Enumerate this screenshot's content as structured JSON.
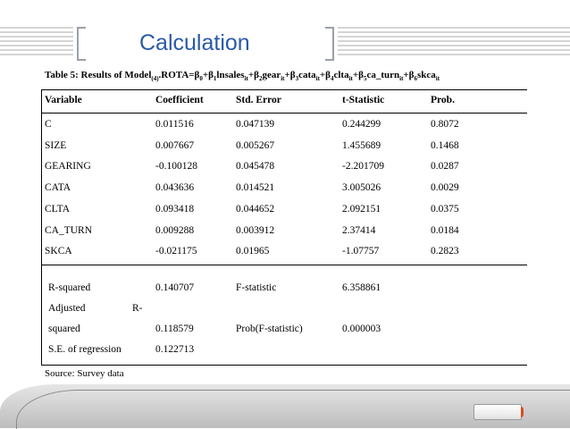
{
  "slide": {
    "title": "Calculation"
  },
  "caption": {
    "prefix": "Table 5: Results of Model",
    "model_sub": "(4)",
    "formula_parts": [
      {
        "t": ".ROTA=β"
      },
      {
        "s": "0"
      },
      {
        "t": "+β"
      },
      {
        "s": "1"
      },
      {
        "t": "lnsales"
      },
      {
        "s": "it"
      },
      {
        "t": "+β"
      },
      {
        "s": "2"
      },
      {
        "t": "gear"
      },
      {
        "s": "it"
      },
      {
        "t": "+β"
      },
      {
        "s": "3"
      },
      {
        "t": "cata"
      },
      {
        "s": "it"
      },
      {
        "t": "+β"
      },
      {
        "s": "4"
      },
      {
        "t": "clta"
      },
      {
        "s": "it"
      },
      {
        "t": "+β"
      },
      {
        "s": "5"
      },
      {
        "t": "ca_turn"
      },
      {
        "s": "it"
      },
      {
        "t": "+β"
      },
      {
        "s": "6"
      },
      {
        "t": "skca"
      },
      {
        "s": "it"
      }
    ]
  },
  "table": {
    "headers": [
      "Variable",
      "Coefficient",
      "Std. Error",
      "t-Statistic",
      "Prob."
    ],
    "rows": [
      [
        "C",
        "0.011516",
        "0.047139",
        "0.244299",
        "0.8072"
      ],
      [
        "SIZE",
        "0.007667",
        "0.005267",
        "1.455689",
        "0.1468"
      ],
      [
        "GEARING",
        "-0.100128",
        "0.045478",
        "-2.201709",
        "0.0287"
      ],
      [
        "CATA",
        "0.043636",
        "0.014521",
        "3.005026",
        "0.0029"
      ],
      [
        "CLTA",
        "0.093418",
        "0.044652",
        "2.092151",
        "0.0375"
      ],
      [
        "CA_TURN",
        "0.009288",
        "0.003912",
        "2.37414",
        "0.0184"
      ],
      [
        "SKCA",
        "-0.021175",
        "0.01965",
        "-1.07757",
        "0.2823"
      ]
    ],
    "stats": {
      "r_squared_label": "R-squared",
      "r_squared_value": "0.140707",
      "f_stat_label": "F-statistic",
      "f_stat_value": "6.358861",
      "adjusted_label_a": "Adjusted",
      "adjusted_label_b": "R-",
      "adjusted_label_c": "squared",
      "adjusted_value": "0.118579",
      "prob_f_label": "Prob(F-statistic)",
      "prob_f_value": "0.000003",
      "se_label": "S.E. of regression",
      "se_value": "0.122713"
    }
  },
  "source": "Source: Survey data"
}
